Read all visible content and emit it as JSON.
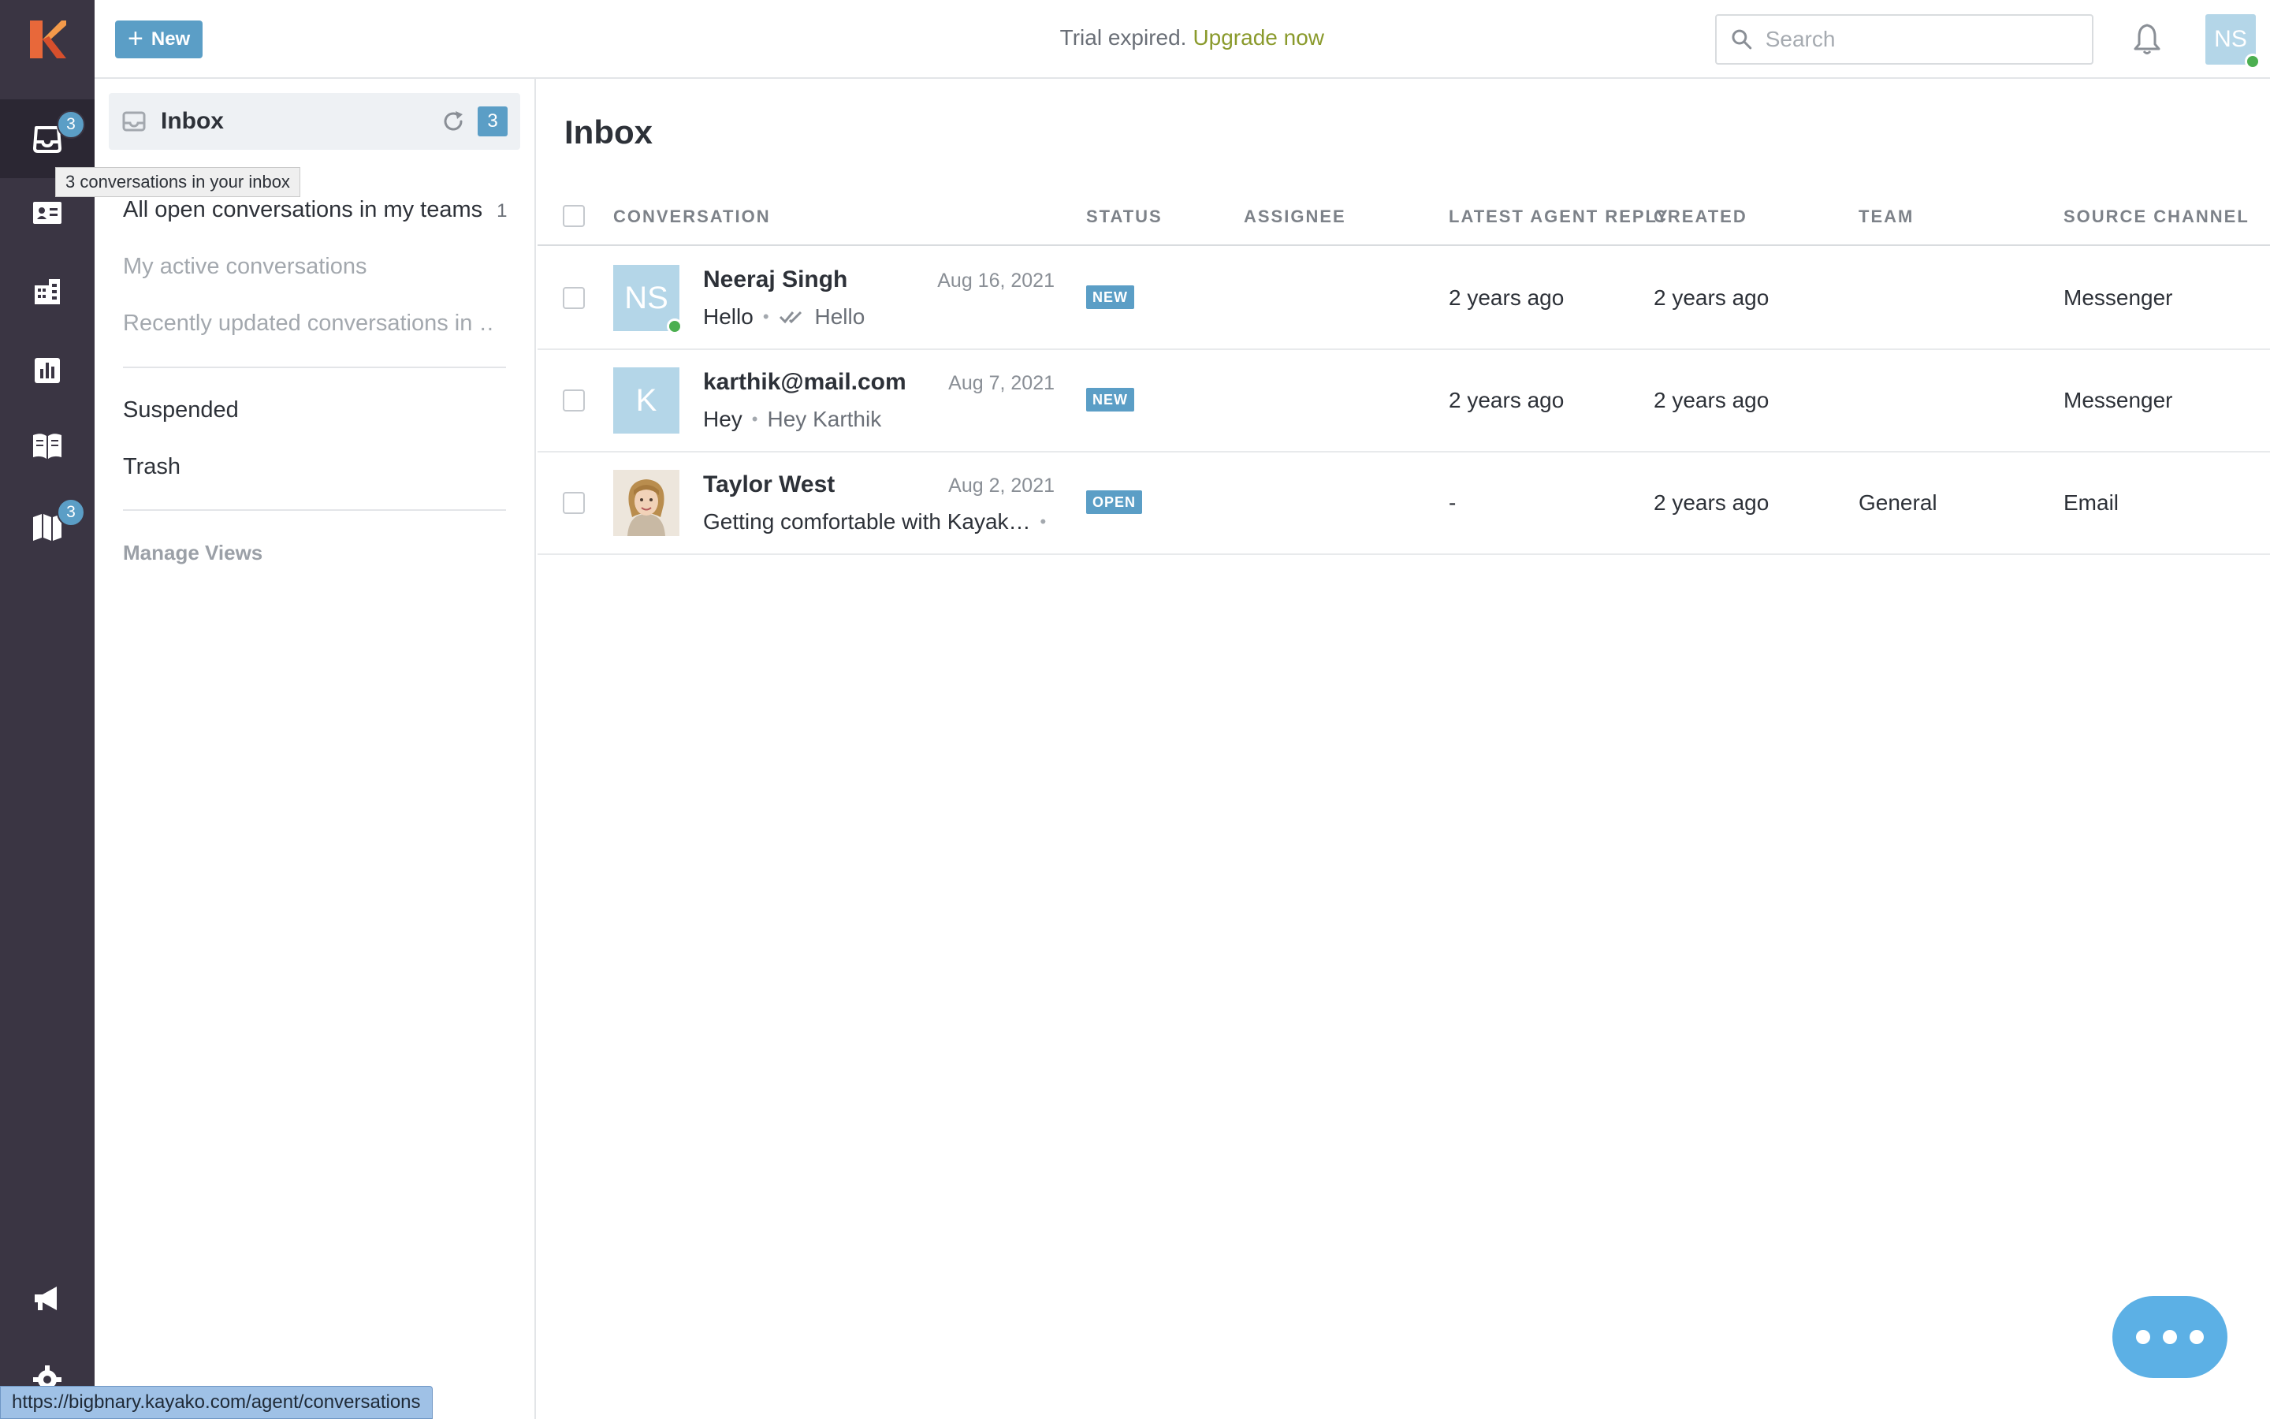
{
  "rail": {
    "items": [
      {
        "name": "inbox",
        "badge": "3",
        "active": true
      },
      {
        "name": "customers",
        "badge": ""
      },
      {
        "name": "organizations",
        "badge": ""
      },
      {
        "name": "insights",
        "badge": ""
      },
      {
        "name": "help-center",
        "badge": ""
      },
      {
        "name": "product-updates",
        "badge": "3"
      },
      {
        "name": "announcements",
        "badge": ""
      },
      {
        "name": "settings",
        "badge": ""
      }
    ]
  },
  "topbar": {
    "new_label": "New",
    "trial_text": "Trial expired.",
    "upgrade_label": "Upgrade now",
    "search_placeholder": "Search",
    "avatar_initials": "NS"
  },
  "views": {
    "inbox_label": "Inbox",
    "inbox_count": "3",
    "tooltip": "3 conversations in your inbox",
    "items": [
      {
        "label": "All open conversations in my teams",
        "count": "1"
      },
      {
        "label": "My active conversations",
        "count": ""
      },
      {
        "label": "Recently updated conversations in …",
        "count": ""
      }
    ],
    "suspended_label": "Suspended",
    "trash_label": "Trash",
    "manage_label": "Manage Views"
  },
  "main": {
    "title": "Inbox",
    "columns": {
      "conversation": "CONVERSATION",
      "status": "STATUS",
      "assignee": "ASSIGNEE",
      "latest_reply": "LATEST AGENT REPLY",
      "created": "CREATED",
      "team": "TEAM",
      "source": "SOURCE CHANNEL"
    },
    "rows": [
      {
        "avatar_initials": "NS",
        "name": "Neeraj Singh",
        "date": "Aug 16, 2021",
        "preview": "Hello",
        "reply": "Hello",
        "status": "NEW",
        "assignee": "",
        "latest_reply": "2 years ago",
        "created": "2 years ago",
        "team": "",
        "source": "Messenger"
      },
      {
        "avatar_initials": "K",
        "name": "karthik@mail.com",
        "date": "Aug 7, 2021",
        "preview": "Hey",
        "reply": "Hey Karthik",
        "status": "NEW",
        "assignee": "",
        "latest_reply": "2 years ago",
        "created": "2 years ago",
        "team": "",
        "source": "Messenger"
      },
      {
        "avatar_initials": "",
        "name": "Taylor West",
        "date": "Aug 2, 2021",
        "preview": "Getting comfortable with Kayak…",
        "reply": "",
        "status": "OPEN",
        "assignee": "",
        "latest_reply": "-",
        "created": "2 years ago",
        "team": "General",
        "source": "Email"
      }
    ]
  },
  "status_url": "https://bigbnary.kayako.com/agent/conversations",
  "colors": {
    "rail": "#3a3543",
    "accent": "#5b9ec6",
    "upgrade": "#8a9a2c",
    "online": "#4caf50",
    "fab": "#5cb0e5"
  }
}
